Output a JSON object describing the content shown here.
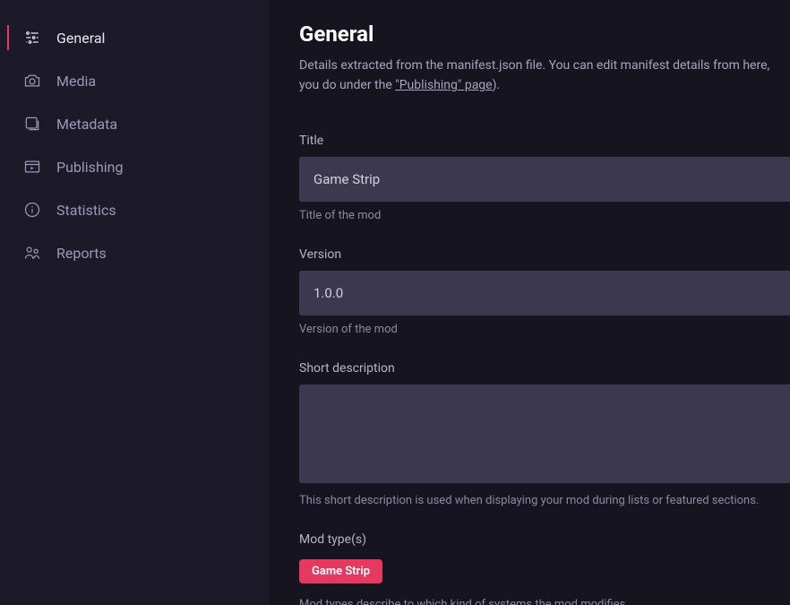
{
  "sidebar": {
    "items": [
      {
        "label": "General"
      },
      {
        "label": "Media"
      },
      {
        "label": "Metadata"
      },
      {
        "label": "Publishing"
      },
      {
        "label": "Statistics"
      },
      {
        "label": "Reports"
      }
    ]
  },
  "page": {
    "title": "General",
    "desc_prefix": "Details extracted from the manifest.json file. You can edit manifest details from here, you do under the ",
    "desc_link": "\"Publishing\" page",
    "desc_suffix": ")."
  },
  "fields": {
    "title": {
      "label": "Title",
      "value": "Game Strip",
      "helper": "Title of the mod"
    },
    "version": {
      "label": "Version",
      "value": "1.0.0",
      "helper": "Version of the mod"
    },
    "short_desc": {
      "label": "Short description",
      "value": "",
      "helper": "This short description is used when displaying your mod during lists or featured sections."
    },
    "mod_types": {
      "label": "Mod type(s)",
      "tag": "Game Strip",
      "helper": "Mod types describe to which kind of systems the mod modifies"
    }
  }
}
